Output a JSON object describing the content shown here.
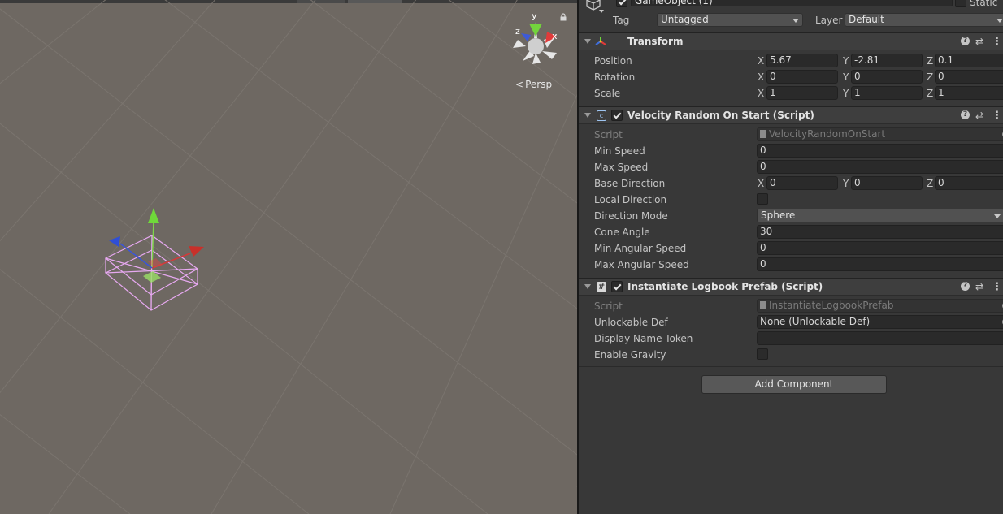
{
  "scene": {
    "view_mode": "Persp",
    "gizmo_axes": {
      "y": "y",
      "x": "x",
      "z": "z"
    }
  },
  "inspector": {
    "object_name": "GameObject (1)",
    "static_label": "Static",
    "tag_label": "Tag",
    "tag_value": "Untagged",
    "layer_label": "Layer",
    "layer_value": "Default",
    "transform": {
      "title": "Transform",
      "rows": [
        {
          "label": "Position",
          "x": "5.67",
          "y": "-2.81",
          "z": "0.1"
        },
        {
          "label": "Rotation",
          "x": "0",
          "y": "0",
          "z": "0"
        },
        {
          "label": "Scale",
          "x": "1",
          "y": "1",
          "z": "1"
        }
      ]
    },
    "velocity": {
      "title": "Velocity Random On Start (Script)",
      "script_label": "Script",
      "script_value": "VelocityRandomOnStart",
      "min_speed_label": "Min Speed",
      "min_speed": "0",
      "max_speed_label": "Max Speed",
      "max_speed": "0",
      "base_direction_label": "Base Direction",
      "base_direction": {
        "x": "0",
        "y": "0",
        "z": "0"
      },
      "local_direction_label": "Local Direction",
      "direction_mode_label": "Direction Mode",
      "direction_mode": "Sphere",
      "cone_angle_label": "Cone Angle",
      "cone_angle": "30",
      "min_angular_label": "Min Angular Speed",
      "min_angular": "0",
      "max_angular_label": "Max Angular Speed",
      "max_angular": "0"
    },
    "logbook": {
      "title": "Instantiate Logbook Prefab (Script)",
      "script_label": "Script",
      "script_value": "InstantiateLogbookPrefab",
      "unlockable_label": "Unlockable Def",
      "unlockable_value": "None (Unlockable Def)",
      "display_name_label": "Display Name Token",
      "display_name_value": "",
      "gravity_label": "Enable Gravity"
    },
    "add_component": "Add Component",
    "axis_x": "X",
    "axis_y": "Y",
    "axis_z": "Z",
    "help_glyph": "?",
    "preset_glyph": "⇄",
    "menu_glyph": "⋮",
    "transform_icon_color": "#f0c020"
  }
}
